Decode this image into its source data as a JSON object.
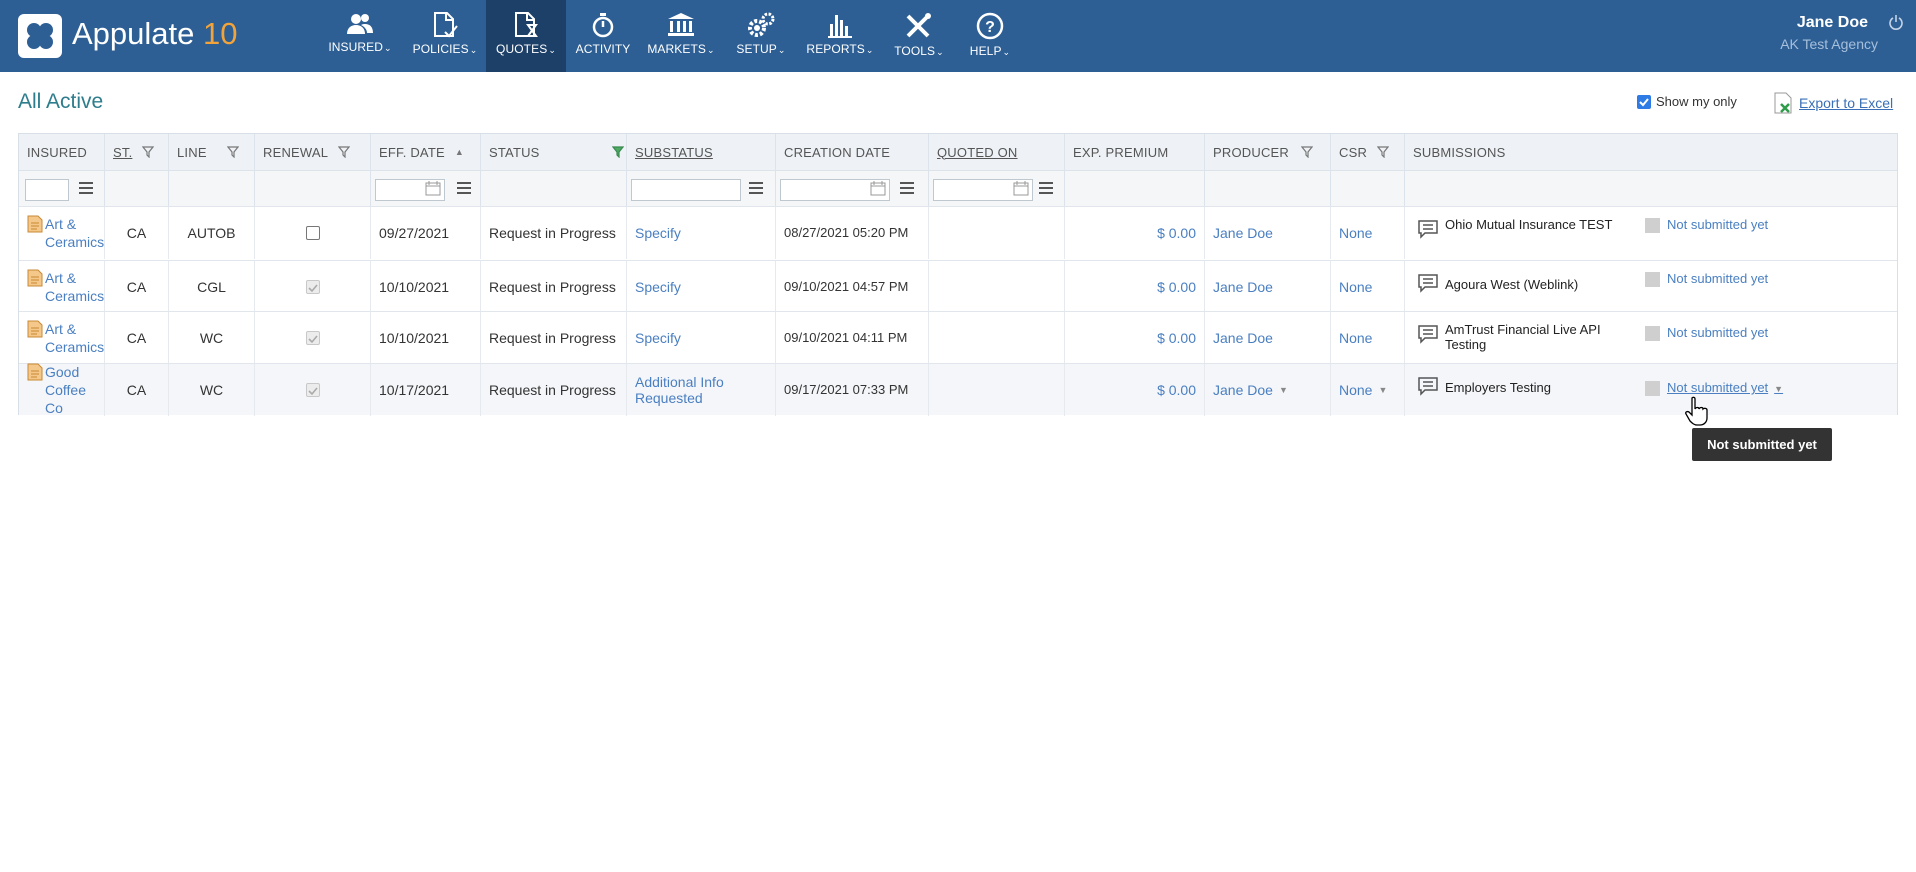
{
  "app": {
    "name": "Appulate",
    "version": "10"
  },
  "nav": [
    {
      "label": "INSURED",
      "icon": "users-icon",
      "dropdown": true
    },
    {
      "label": "POLICIES",
      "icon": "policy-doc-icon",
      "dropdown": true
    },
    {
      "label": "QUOTES",
      "icon": "quote-hourglass-icon",
      "dropdown": true,
      "active": true
    },
    {
      "label": "ACTIVITY",
      "icon": "stopwatch-icon",
      "dropdown": false
    },
    {
      "label": "MARKETS",
      "icon": "bank-icon",
      "dropdown": true
    },
    {
      "label": "SETUP",
      "icon": "gears-icon",
      "dropdown": true
    },
    {
      "label": "REPORTS",
      "icon": "bar-chart-icon",
      "dropdown": true
    },
    {
      "label": "TOOLS",
      "icon": "tools-icon",
      "dropdown": true
    },
    {
      "label": "HELP",
      "icon": "help-icon",
      "dropdown": true
    }
  ],
  "user": {
    "name": "Jane Doe",
    "agency": "AK Test Agency"
  },
  "page": {
    "title": "All Active",
    "show_my_only": "Show my only",
    "export": "Export to Excel"
  },
  "grid": {
    "columns": [
      "INSURED",
      "ST.",
      "LINE",
      "RENEWAL",
      "EFF. DATE",
      "STATUS",
      "SUBSTATUS",
      "CREATION DATE",
      "QUOTED ON",
      "EXP. PREMIUM",
      "PRODUCER",
      "CSR",
      "SUBMISSIONS"
    ],
    "rows": [
      {
        "insured": "Art & Ceramics",
        "st": "CA",
        "line": "AUTOB",
        "renewal": false,
        "eff_date": "09/27/2021",
        "status": "Request in Progress",
        "substatus": "Specify",
        "creation_date": "08/27/2021 05:20 PM",
        "quoted_on": "",
        "premium": "$ 0.00",
        "producer": "Jane Doe",
        "csr": "None",
        "submission_market": "Ohio Mutual Insurance TEST",
        "submission_status": "Not submitted yet"
      },
      {
        "insured": "Art & Ceramics",
        "st": "CA",
        "line": "CGL",
        "renewal": true,
        "eff_date": "10/10/2021",
        "status": "Request in Progress",
        "substatus": "Specify",
        "creation_date": "09/10/2021 04:57 PM",
        "quoted_on": "",
        "premium": "$ 0.00",
        "producer": "Jane Doe",
        "csr": "None",
        "submission_market": "Agoura West (Weblink)",
        "submission_status": "Not submitted yet"
      },
      {
        "insured": "Art & Ceramics",
        "st": "CA",
        "line": "WC",
        "renewal": true,
        "eff_date": "10/10/2021",
        "status": "Request in Progress",
        "substatus": "Specify",
        "creation_date": "09/10/2021 04:11 PM",
        "quoted_on": "",
        "premium": "$ 0.00",
        "producer": "Jane Doe",
        "csr": "None",
        "submission_market": "AmTrust Financial Live API Testing",
        "submission_status": "Not submitted yet"
      },
      {
        "insured": "Good Coffee Co",
        "st": "CA",
        "line": "WC",
        "renewal": true,
        "eff_date": "10/17/2021",
        "status": "Request in Progress",
        "substatus": "Additional Info Requested",
        "creation_date": "09/17/2021 07:33 PM",
        "quoted_on": "",
        "premium": "$ 0.00",
        "producer": "Jane Doe",
        "csr": "None",
        "submission_market": "Employers Testing",
        "submission_status": "Not submitted yet"
      }
    ]
  },
  "tooltip": "Not submitted yet",
  "colors": {
    "topbar": "#2d5f95",
    "active_nav": "#1d4068",
    "link": "#4a7fc1",
    "title": "#2e7d8c",
    "brand_accent": "#f2a33a"
  }
}
